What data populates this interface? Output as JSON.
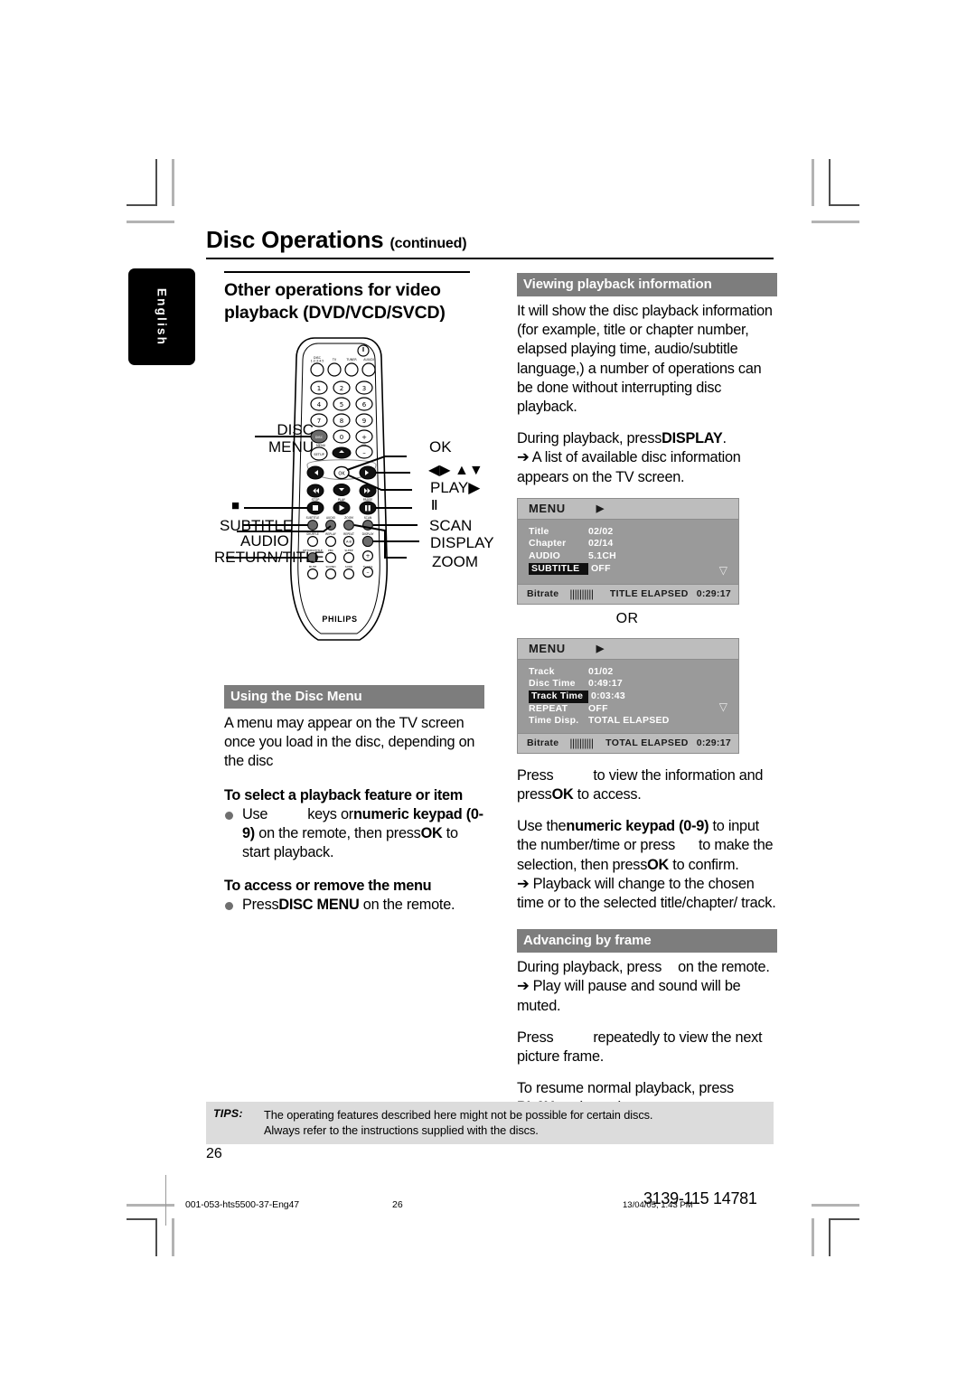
{
  "document": {
    "title": "Disc Operations",
    "title_suffix": "(continued)",
    "language_tab": "English",
    "page_number": "26"
  },
  "left_column": {
    "heading": "Other operations for video playback (DVD/VCD/SVCD)",
    "disc_menu": {
      "section_title": "Using the Disc Menu",
      "intro": "A menu may appear on the TV screen once you load in the disc, depending on the disc",
      "subhead_select": "To select a playback feature or item",
      "bullet_select_1": "Use",
      "bullet_select_2": "keys or",
      "bullet_select_3": "numeric keypad (0-9)",
      "bullet_select_4": "on the remote, then press",
      "bullet_select_5": "OK",
      "bullet_select_6": "to start playback.",
      "subhead_access": "To access or remove the menu",
      "bullet_access_1": "Press",
      "bullet_access_2": "DISC MENU",
      "bullet_access_3": "on the remote."
    }
  },
  "right_column": {
    "viewing": {
      "section_title": "Viewing playback information",
      "para1": "It will show the disc playback information (for example, title or chapter number, elapsed playing time, audio/subtitle language,) a number of operations can be done without interrupting disc playback.",
      "para2_a": "During playback, press",
      "para2_b": "DISPLAY",
      "para2_c": ".",
      "para2_arrow": "➔ A list of available disc information appears on the TV screen."
    },
    "or_label": "OR",
    "press_info": {
      "line1_a": "Press",
      "line1_b": "to view the information and press",
      "line1_c": "OK",
      "line1_d": "to access.",
      "line2_a": "Use the",
      "line2_b": "numeric keypad (0-9)",
      "line2_c": "to input the number/time or press",
      "line2_d": "to make the selection, then press",
      "line2_e": "OK",
      "line2_f": "to confirm.",
      "line3": "➔ Playback will change to the chosen time or to the selected title/chapter/ track."
    },
    "advancing": {
      "section_title": "Advancing by frame",
      "line1_a": "During playback, press",
      "line1_b": "on the remote.",
      "line2": "➔ Play will pause and sound will be muted.",
      "line3_a": "Press",
      "line3_b": "repeatedly to view the next picture frame.",
      "line4_a": "To resume normal playback, press",
      "line4_b": "PLAY",
      "line4_c": "(or",
      "line4_d": ")."
    }
  },
  "osd_screens": [
    {
      "name": "dvd-info-screen",
      "menu_label": "MENU",
      "menu_arrow": "▶",
      "rows": [
        {
          "key": "Title",
          "value": "02/02",
          "highlighted": false
        },
        {
          "key": "Chapter",
          "value": "02/14",
          "highlighted": false
        },
        {
          "key": "AUDIO",
          "value": "5.1CH",
          "highlighted": false
        },
        {
          "key": "SUBTITLE",
          "value": "OFF",
          "highlighted": true
        }
      ],
      "down_arrow": "▽",
      "footer_label": "Bitrate",
      "footer_bars": "||||||||||",
      "footer_status": "TITLE ELAPSED",
      "footer_time": "0:29:17"
    },
    {
      "name": "vcd-info-screen",
      "menu_label": "MENU",
      "menu_arrow": "▶",
      "rows": [
        {
          "key": "Track",
          "value": "01/02",
          "highlighted": false
        },
        {
          "key": "Disc Time",
          "value": "0:49:17",
          "highlighted": false
        },
        {
          "key": "Track Time",
          "value": "0:03:43",
          "highlighted": true
        },
        {
          "key": "REPEAT",
          "value": "OFF",
          "highlighted": false
        },
        {
          "key": "Time Disp.",
          "value": "TOTAL ELAPSED",
          "highlighted": false
        }
      ],
      "down_arrow": "▽",
      "footer_label": "Bitrate",
      "footer_bars": "||||||||||",
      "footer_status": "TOTAL ELAPSED",
      "footer_time": "0:29:17"
    }
  ],
  "remote": {
    "brand": "PHILIPS",
    "callouts_left": [
      {
        "label": "DISC",
        "label2": "MENU"
      },
      {
        "label": "■"
      },
      {
        "label": "SUBTITLE"
      },
      {
        "label": "AUDIO"
      },
      {
        "label": "RETURN/TITLE"
      }
    ],
    "callouts_right": [
      {
        "label": "OK"
      },
      {
        "label": "◀▶  ▲▼"
      },
      {
        "label": "PLAY▶"
      },
      {
        "label": "‖"
      },
      {
        "label": "SCAN"
      },
      {
        "label": "DISPLAY"
      },
      {
        "label": "ZOOM"
      }
    ],
    "top_row_labels": [
      "DISC 1·2·3·4·5",
      "TV",
      "TUNER",
      "AUX/DI"
    ],
    "keypad": [
      "1",
      "2",
      "3",
      "4",
      "5",
      "6",
      "7",
      "8",
      "9",
      "0"
    ],
    "vol_plus": "+",
    "vol_label": "VOL",
    "vol_minus": "−",
    "disc_btn": "DISC",
    "menu_small": "MENU",
    "setup_btn": "SETUP",
    "ok_btn": "OK",
    "transport_labels": [
      "STOP",
      "PLAY",
      "PAUSE"
    ],
    "fn_row1": [
      "SUBTITLE",
      "AUDIO",
      "ZOOM",
      "SCAN"
    ],
    "fn_row2": [
      "SHUFFLE",
      "REPLAY",
      "REPEAT",
      "DISPLAY"
    ],
    "ab_btn": "A-B",
    "fn_row3": [
      "RETURN/TITLE",
      "PBC",
      "SLEEP"
    ],
    "fn_row4": [
      "MUTE",
      "SOUND",
      "SURR",
      "TV VOL"
    ],
    "tv_vol_plus": "+",
    "tv_vol_minus": "−"
  },
  "tips": {
    "label": "TIPS:",
    "line1": "The operating features described here might not be possible for certain discs.",
    "line2": "Always refer to the instructions supplied with the discs."
  },
  "print_footer": {
    "filename": "001-053-hts5500-37-Eng47",
    "page": "26",
    "timestamp": "13/04/05, 1:43 PM",
    "code": "3139-115 14781"
  }
}
